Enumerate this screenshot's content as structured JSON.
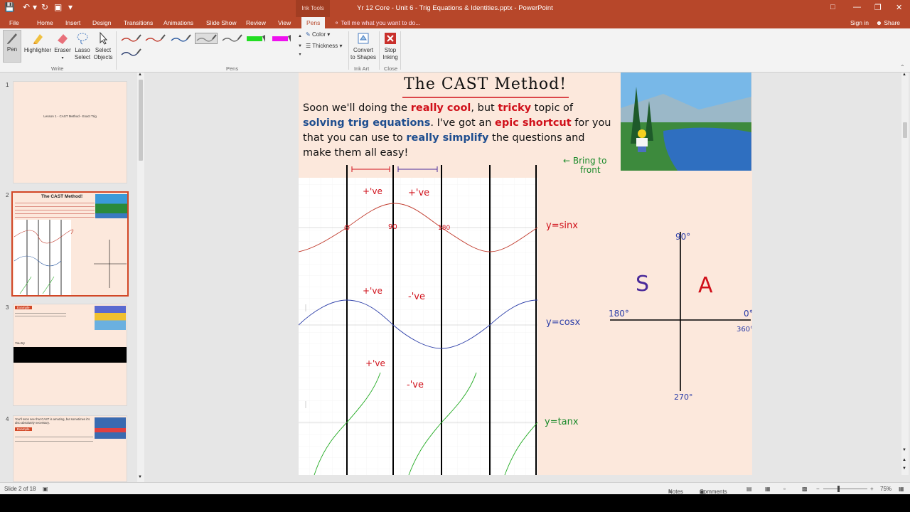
{
  "titlebar": {
    "title": "Yr 12 Core - Unit 6 - Trig Equations & Identities.pptx - PowerPoint",
    "contextual": "Ink Tools"
  },
  "tabs": [
    "File",
    "Home",
    "Insert",
    "Design",
    "Transitions",
    "Animations",
    "Slide Show",
    "Review",
    "View",
    "Pens"
  ],
  "tell_me": "Tell me what you want to do...",
  "account": {
    "sign_in": "Sign in",
    "share": "Share"
  },
  "ribbon": {
    "write": {
      "label": "Write",
      "pen": "Pen",
      "highlighter": "Highlighter",
      "eraser": "Eraser",
      "lasso1": "Lasso",
      "lasso2": "Select",
      "select1": "Select",
      "select2": "Objects"
    },
    "pens": {
      "label": "Pens",
      "color": "Color",
      "thickness": "Thickness"
    },
    "ink_art": {
      "label": "Ink Art",
      "convert1": "Convert",
      "convert2": "to Shapes"
    },
    "close": {
      "label": "Close",
      "stop1": "Stop",
      "stop2": "Inking"
    },
    "pen_colors": [
      "#c0392b",
      "#c0392b",
      "#2c5aa0",
      "#888888",
      "#666666",
      "#22dd22",
      "#ee11ee",
      "#2c3e70"
    ]
  },
  "thumbnails": [
    {
      "num": "1",
      "text": "Lesson 1 - CAST Method - Exact Trig"
    },
    {
      "num": "2",
      "text": "The CAST Method!"
    },
    {
      "num": "3",
      "text": "Example",
      "sub": "You try"
    },
    {
      "num": "4",
      "text": "You'll soon see that CAST is amazing, but sometimes it's also absolutely necessary.",
      "sub": "Example"
    }
  ],
  "slide": {
    "title": "The CAST Method!",
    "intro": {
      "p1": "Soon we'll doing the ",
      "r1": "really cool",
      "p2": ", but ",
      "r2": "tricky",
      "p3": " topic of ",
      "b1": "solving trig equations",
      "p4": ".  I've got an ",
      "r3": "epic shortcut",
      "p5": " for you that you can use to ",
      "b2": "really simplify",
      "p6": " the questions and make them all easy!"
    },
    "annotations": {
      "bring_to_front": [
        "Bring to",
        "front"
      ],
      "sin_label": "y=sinx",
      "cos_label": "y=cosx",
      "tan_label": "y=tanx",
      "sin_pos": "+'ve",
      "sin_pos2": "+'ve",
      "cos_pos": "+'ve",
      "cos_neg": "-'ve",
      "tan_pos": "+'ve",
      "tan_neg": "-'ve",
      "zero": "0",
      "ninety": "90",
      "oneeighty": "180",
      "s": "S",
      "a": "A",
      "deg90": "90°",
      "deg180": "180°",
      "deg0": "0°",
      "deg360": "360°",
      "deg270": "270°"
    }
  },
  "status": {
    "slide": "Slide 2 of 18",
    "notes": "Notes",
    "comments": "Comments",
    "zoom": "75%"
  },
  "colors": {
    "accent": "#b7472a",
    "slide_bg": "#fce8dc"
  }
}
